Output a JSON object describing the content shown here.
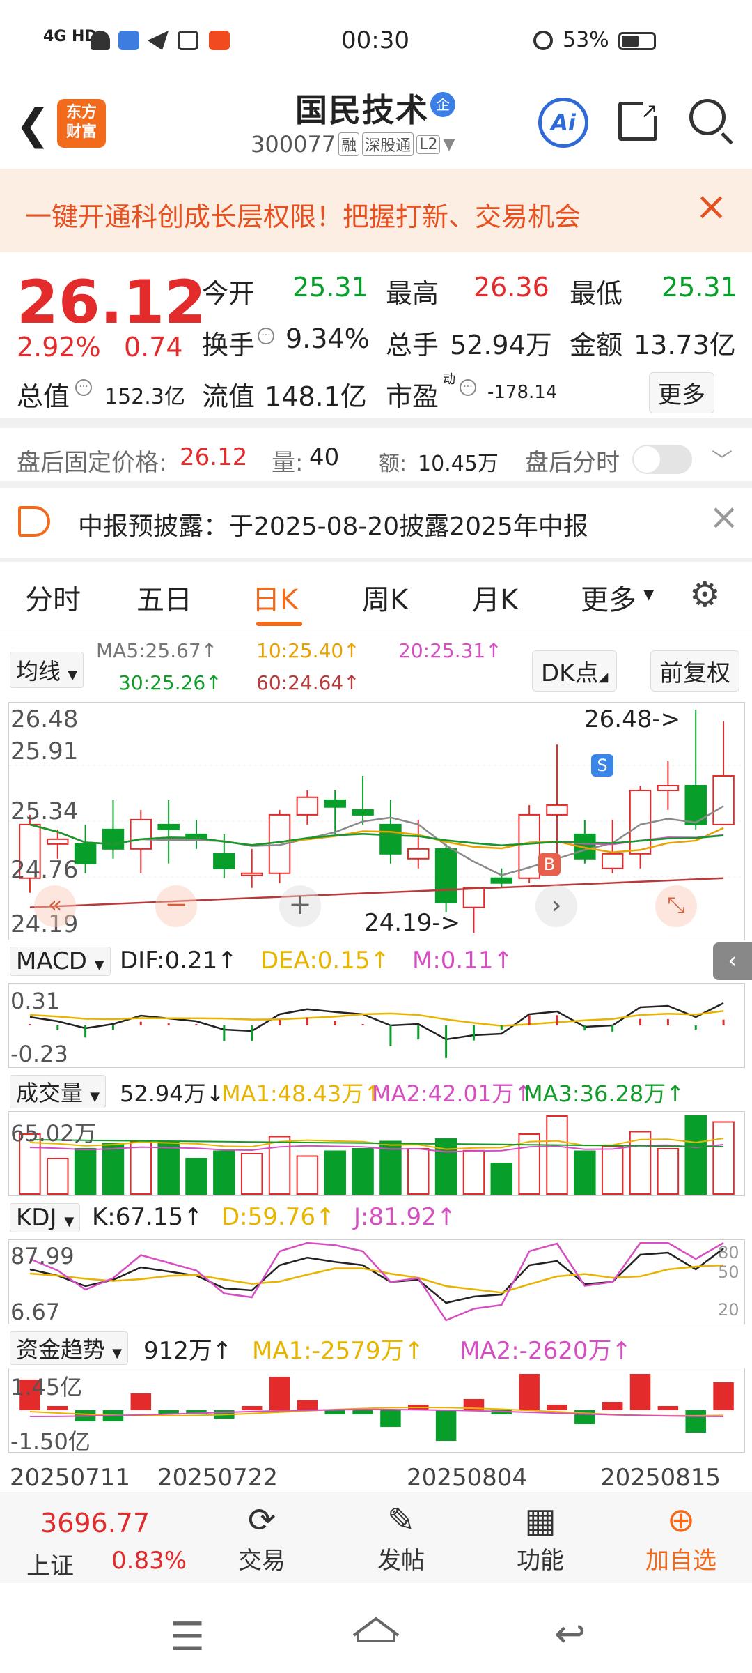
{
  "status": {
    "time": "00:30",
    "battery": "53%",
    "network": "4G HD"
  },
  "header": {
    "logo_line1": "东方",
    "logo_line2": "财富",
    "title": "国民技术",
    "badge": "企",
    "code": "300077",
    "tags": [
      "融",
      "深股通",
      "L2"
    ],
    "ai_label": "Ai"
  },
  "banner": {
    "text": "一键开通科创成长层权限！把握打新、交易机会"
  },
  "quote": {
    "price": "26.12",
    "change_pct": "2.92%",
    "change": "0.74",
    "open_label": "今开",
    "open": "25.31",
    "high_label": "最高",
    "high": "26.36",
    "low_label": "最低",
    "low": "25.31",
    "turnover_label": "换手",
    "turnover": "9.34%",
    "volume_label": "总手",
    "volume": "52.94万",
    "amount_label": "金额",
    "amount": "13.73亿",
    "mktcap_label": "总值",
    "mktcap": "152.3亿",
    "float_label": "流值",
    "float": "148.1亿",
    "pe_label": "市盈",
    "pe_sup": "动",
    "pe": "-178.14",
    "more": "更多"
  },
  "afterhours": {
    "label": "盘后固定价格:",
    "price": "26.12",
    "vol_label": "量:",
    "vol": "40",
    "amt_label": "额:",
    "amt": "10.45万",
    "intraday_label": "盘后分时"
  },
  "notice": {
    "text": "中报预披露：于2025-08-20披露2025年中报"
  },
  "tabs": [
    "分时",
    "五日",
    "日K",
    "周K",
    "月K",
    "更多"
  ],
  "ma": {
    "selector": "均线",
    "ma5": "MA5:25.67↑",
    "ma10": "10:25.40↑",
    "ma20": "20:25.31↑",
    "ma30": "30:25.26↑",
    "ma60": "60:24.64↑",
    "dk": "DK点",
    "adjust": "前复权"
  },
  "kchart": {
    "ymax": "26.48",
    "y2": "25.91",
    "y3": "25.34",
    "y4": "24.76",
    "ymin": "24.19",
    "hi_marker": "26.48->",
    "lo_marker": "24.19->",
    "s_label": "S",
    "b_label": "B"
  },
  "macd": {
    "name": "MACD",
    "dif": "DIF:0.21↑",
    "dea": "DEA:0.15↑",
    "m": "M:0.11↑",
    "ytop": "0.31",
    "ybot": "-0.23"
  },
  "vol": {
    "name": "成交量",
    "value": "52.94万↓",
    "ma1": "MA1:48.43万↑",
    "ma2": "MA2:42.01万↑",
    "ma3": "MA3:36.28万↑",
    "ytop": "65.02万"
  },
  "kdj": {
    "name": "KDJ",
    "k": "K:67.15↑",
    "d": "D:59.76↑",
    "j": "J:81.92↑",
    "ytop": "87.99",
    "ybot": "6.67",
    "r80": "80",
    "r50": "50",
    "r20": "20"
  },
  "fund": {
    "name": "资金趋势",
    "value": "912万↑",
    "ma1": "MA1:-2579万↑",
    "ma2": "MA2:-2620万↑",
    "ytop": "1.45亿",
    "ybot": "-1.50亿"
  },
  "dates": [
    "20250711",
    "20250722",
    "20250804",
    "20250815"
  ],
  "bottom": {
    "index_value": "3696.77",
    "index_name": "上证",
    "index_pct": "0.83%",
    "trade": "交易",
    "post": "发帖",
    "func": "功能",
    "add": "加自选"
  },
  "colors": {
    "up": "#e32b2b",
    "down": "#079f2a",
    "accent": "#f26a1b"
  },
  "chart_data": {
    "type": "candlestick",
    "ylim": [
      24.19,
      26.48
    ],
    "candles": [
      {
        "o": 24.75,
        "c": 25.3,
        "h": 25.4,
        "l": 24.6
      },
      {
        "o": 25.1,
        "c": 25.15,
        "h": 25.25,
        "l": 24.95
      },
      {
        "o": 25.1,
        "c": 24.9,
        "h": 25.3,
        "l": 24.8
      },
      {
        "o": 25.25,
        "c": 25.05,
        "h": 25.55,
        "l": 24.95
      },
      {
        "o": 25.05,
        "c": 25.35,
        "h": 25.45,
        "l": 24.8
      },
      {
        "o": 25.3,
        "c": 25.25,
        "h": 25.55,
        "l": 24.9
      },
      {
        "o": 25.2,
        "c": 25.15,
        "h": 25.35,
        "l": 25.05
      },
      {
        "o": 25.0,
        "c": 24.85,
        "h": 25.2,
        "l": 24.75
      },
      {
        "o": 24.78,
        "c": 24.8,
        "h": 25.05,
        "l": 24.65
      },
      {
        "o": 24.8,
        "c": 25.4,
        "h": 25.45,
        "l": 24.7
      },
      {
        "o": 25.4,
        "c": 25.58,
        "h": 25.65,
        "l": 25.3
      },
      {
        "o": 25.55,
        "c": 25.48,
        "h": 25.65,
        "l": 25.2
      },
      {
        "o": 25.45,
        "c": 25.4,
        "h": 25.8,
        "l": 25.3
      },
      {
        "o": 25.3,
        "c": 25.0,
        "h": 25.55,
        "l": 24.9
      },
      {
        "o": 24.95,
        "c": 25.05,
        "h": 25.35,
        "l": 24.85
      },
      {
        "o": 25.05,
        "c": 24.5,
        "h": 25.1,
        "l": 24.4
      },
      {
        "o": 24.45,
        "c": 24.65,
        "h": 24.65,
        "l": 24.19
      },
      {
        "o": 24.75,
        "c": 24.7,
        "h": 24.85,
        "l": 24.65
      },
      {
        "o": 24.75,
        "c": 25.4,
        "h": 25.5,
        "l": 24.7
      },
      {
        "o": 25.4,
        "c": 25.5,
        "h": 26.12,
        "l": 24.85
      },
      {
        "o": 25.2,
        "c": 24.95,
        "h": 25.35,
        "l": 24.9
      },
      {
        "o": 24.85,
        "c": 25.0,
        "h": 25.35,
        "l": 24.8
      },
      {
        "o": 25.0,
        "c": 25.65,
        "h": 25.7,
        "l": 24.85
      },
      {
        "o": 25.65,
        "c": 25.7,
        "h": 25.95,
        "l": 25.45
      },
      {
        "o": 25.7,
        "c": 25.3,
        "h": 26.48,
        "l": 25.25
      },
      {
        "o": 25.3,
        "c": 25.8,
        "h": 26.36,
        "l": 25.31
      }
    ]
  }
}
